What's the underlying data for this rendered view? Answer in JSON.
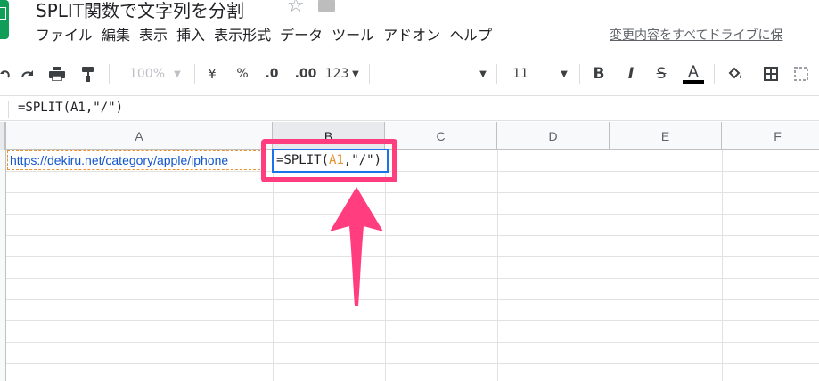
{
  "app": {
    "document_title": "SPLIT関数で文字列を分割",
    "last_edit_text": "変更内容をすべてドライブに保"
  },
  "menu": [
    "ファイル",
    "編集",
    "表示",
    "挿入",
    "表示形式",
    "データ",
    "ツール",
    "アドオン",
    "ヘルプ"
  ],
  "toolbar": {
    "zoom": "100%",
    "currency": "¥",
    "percent": "%",
    "decrease_decimal": ".0",
    "increase_decimal": ".00",
    "more_formats": "123",
    "font_size": "11",
    "bold": "B",
    "italic": "I",
    "strikethrough": "S",
    "text_color": "A"
  },
  "formula_bar": {
    "text": "=SPLIT(A1,\"/\")"
  },
  "columns": [
    "A",
    "B",
    "C",
    "D",
    "E",
    "F"
  ],
  "cells": {
    "a1": "https://dekiru.net/category/apple/iphone",
    "b1_editor": {
      "prefix": "=SPLIT(",
      "ref": "A1",
      "suffix": ",\"/\")"
    }
  },
  "colors": {
    "highlight": "#ff3d7f",
    "selection": "#1a73e8",
    "reference": "#e8912d",
    "sheets_green": "#0f9d58"
  }
}
